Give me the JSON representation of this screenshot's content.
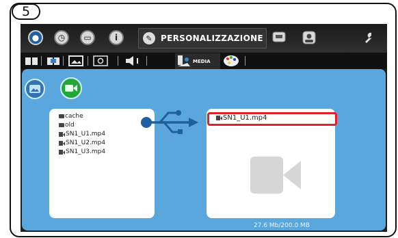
{
  "step_number": "5",
  "topbar": {
    "active_tab_label": "PERSONALIZZAZIONE",
    "icons": [
      "drop-icon",
      "clock-icon",
      "message-icon",
      "info-icon",
      "pencil-icon",
      "display-icon",
      "profile-icon",
      "wrench-icon"
    ]
  },
  "subbar": {
    "media_tab_label": "MEDIA",
    "icons": [
      "book-icon",
      "book-open-icon",
      "image-frame-icon",
      "monitor-icon",
      "speaker-icon",
      "media-icon",
      "palette-icon"
    ]
  },
  "media": {
    "mode_buttons": [
      "image-mode",
      "video-mode"
    ],
    "source_files": [
      {
        "type": "folder",
        "name": "cache"
      },
      {
        "type": "folder",
        "name": "old"
      },
      {
        "type": "video",
        "name": "SN1_U1.mp4"
      },
      {
        "type": "video",
        "name": "SN1_U2.mp4"
      },
      {
        "type": "video",
        "name": "SN1_U3.mp4"
      }
    ],
    "destination_files": [
      {
        "type": "video",
        "name": "SN1_U1.mp4"
      }
    ],
    "storage_usage": "27.6 Mb/200.0 MB"
  },
  "colors": {
    "panel_blue": "#5aa7dd",
    "selection_red": "#e0202a",
    "video_green": "#22a83a",
    "image_blue": "#2f73b8"
  }
}
